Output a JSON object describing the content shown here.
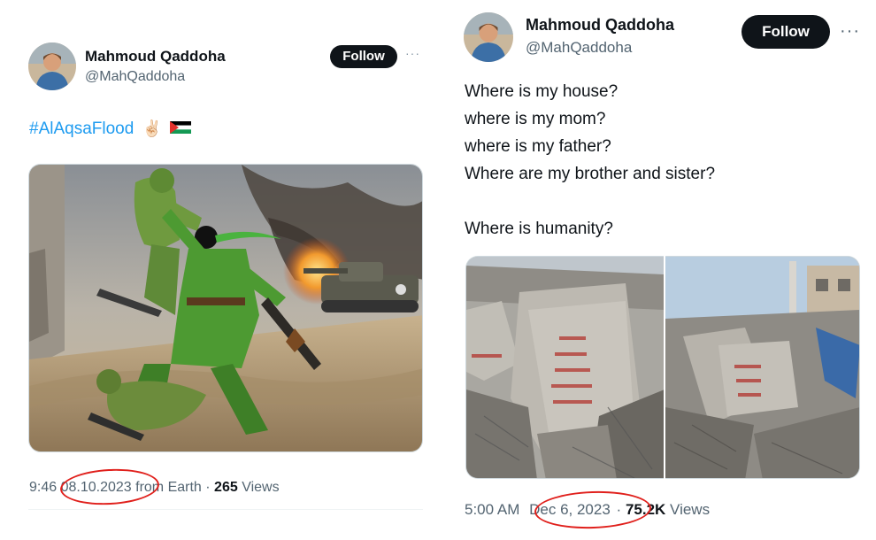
{
  "left_tweet": {
    "display_name": "Mahmoud Qaddoha",
    "handle": "@MahQaddoha",
    "follow_label": "Follow",
    "more_label": "···",
    "hashtag": "#AlAqsaFlood",
    "emojis": "✌🏻",
    "time": "9:46",
    "date": "08.10.2023",
    "source": "from Earth ·",
    "views_count": "265",
    "views_label": "Views",
    "colors": {
      "flag_green": "#149954",
      "flag_red": "#e4312b"
    }
  },
  "right_tweet": {
    "display_name": "Mahmoud Qaddoha",
    "handle": "@MahQaddoha",
    "follow_label": "Follow",
    "more_label": "···",
    "text_lines": [
      "Where is my house?",
      "where is my mom?",
      "where is my father?",
      "Where are my brother and sister?",
      "",
      "Where is humanity?"
    ],
    "time": "5:00 AM",
    "date": "Dec 6, 2023",
    "views_count": "75.2K",
    "views_label": "Views"
  },
  "highlight_color": "#e0201c",
  "brand": {
    "text": "#0f1419",
    "muted": "#536471",
    "link": "#1d9bf0"
  }
}
